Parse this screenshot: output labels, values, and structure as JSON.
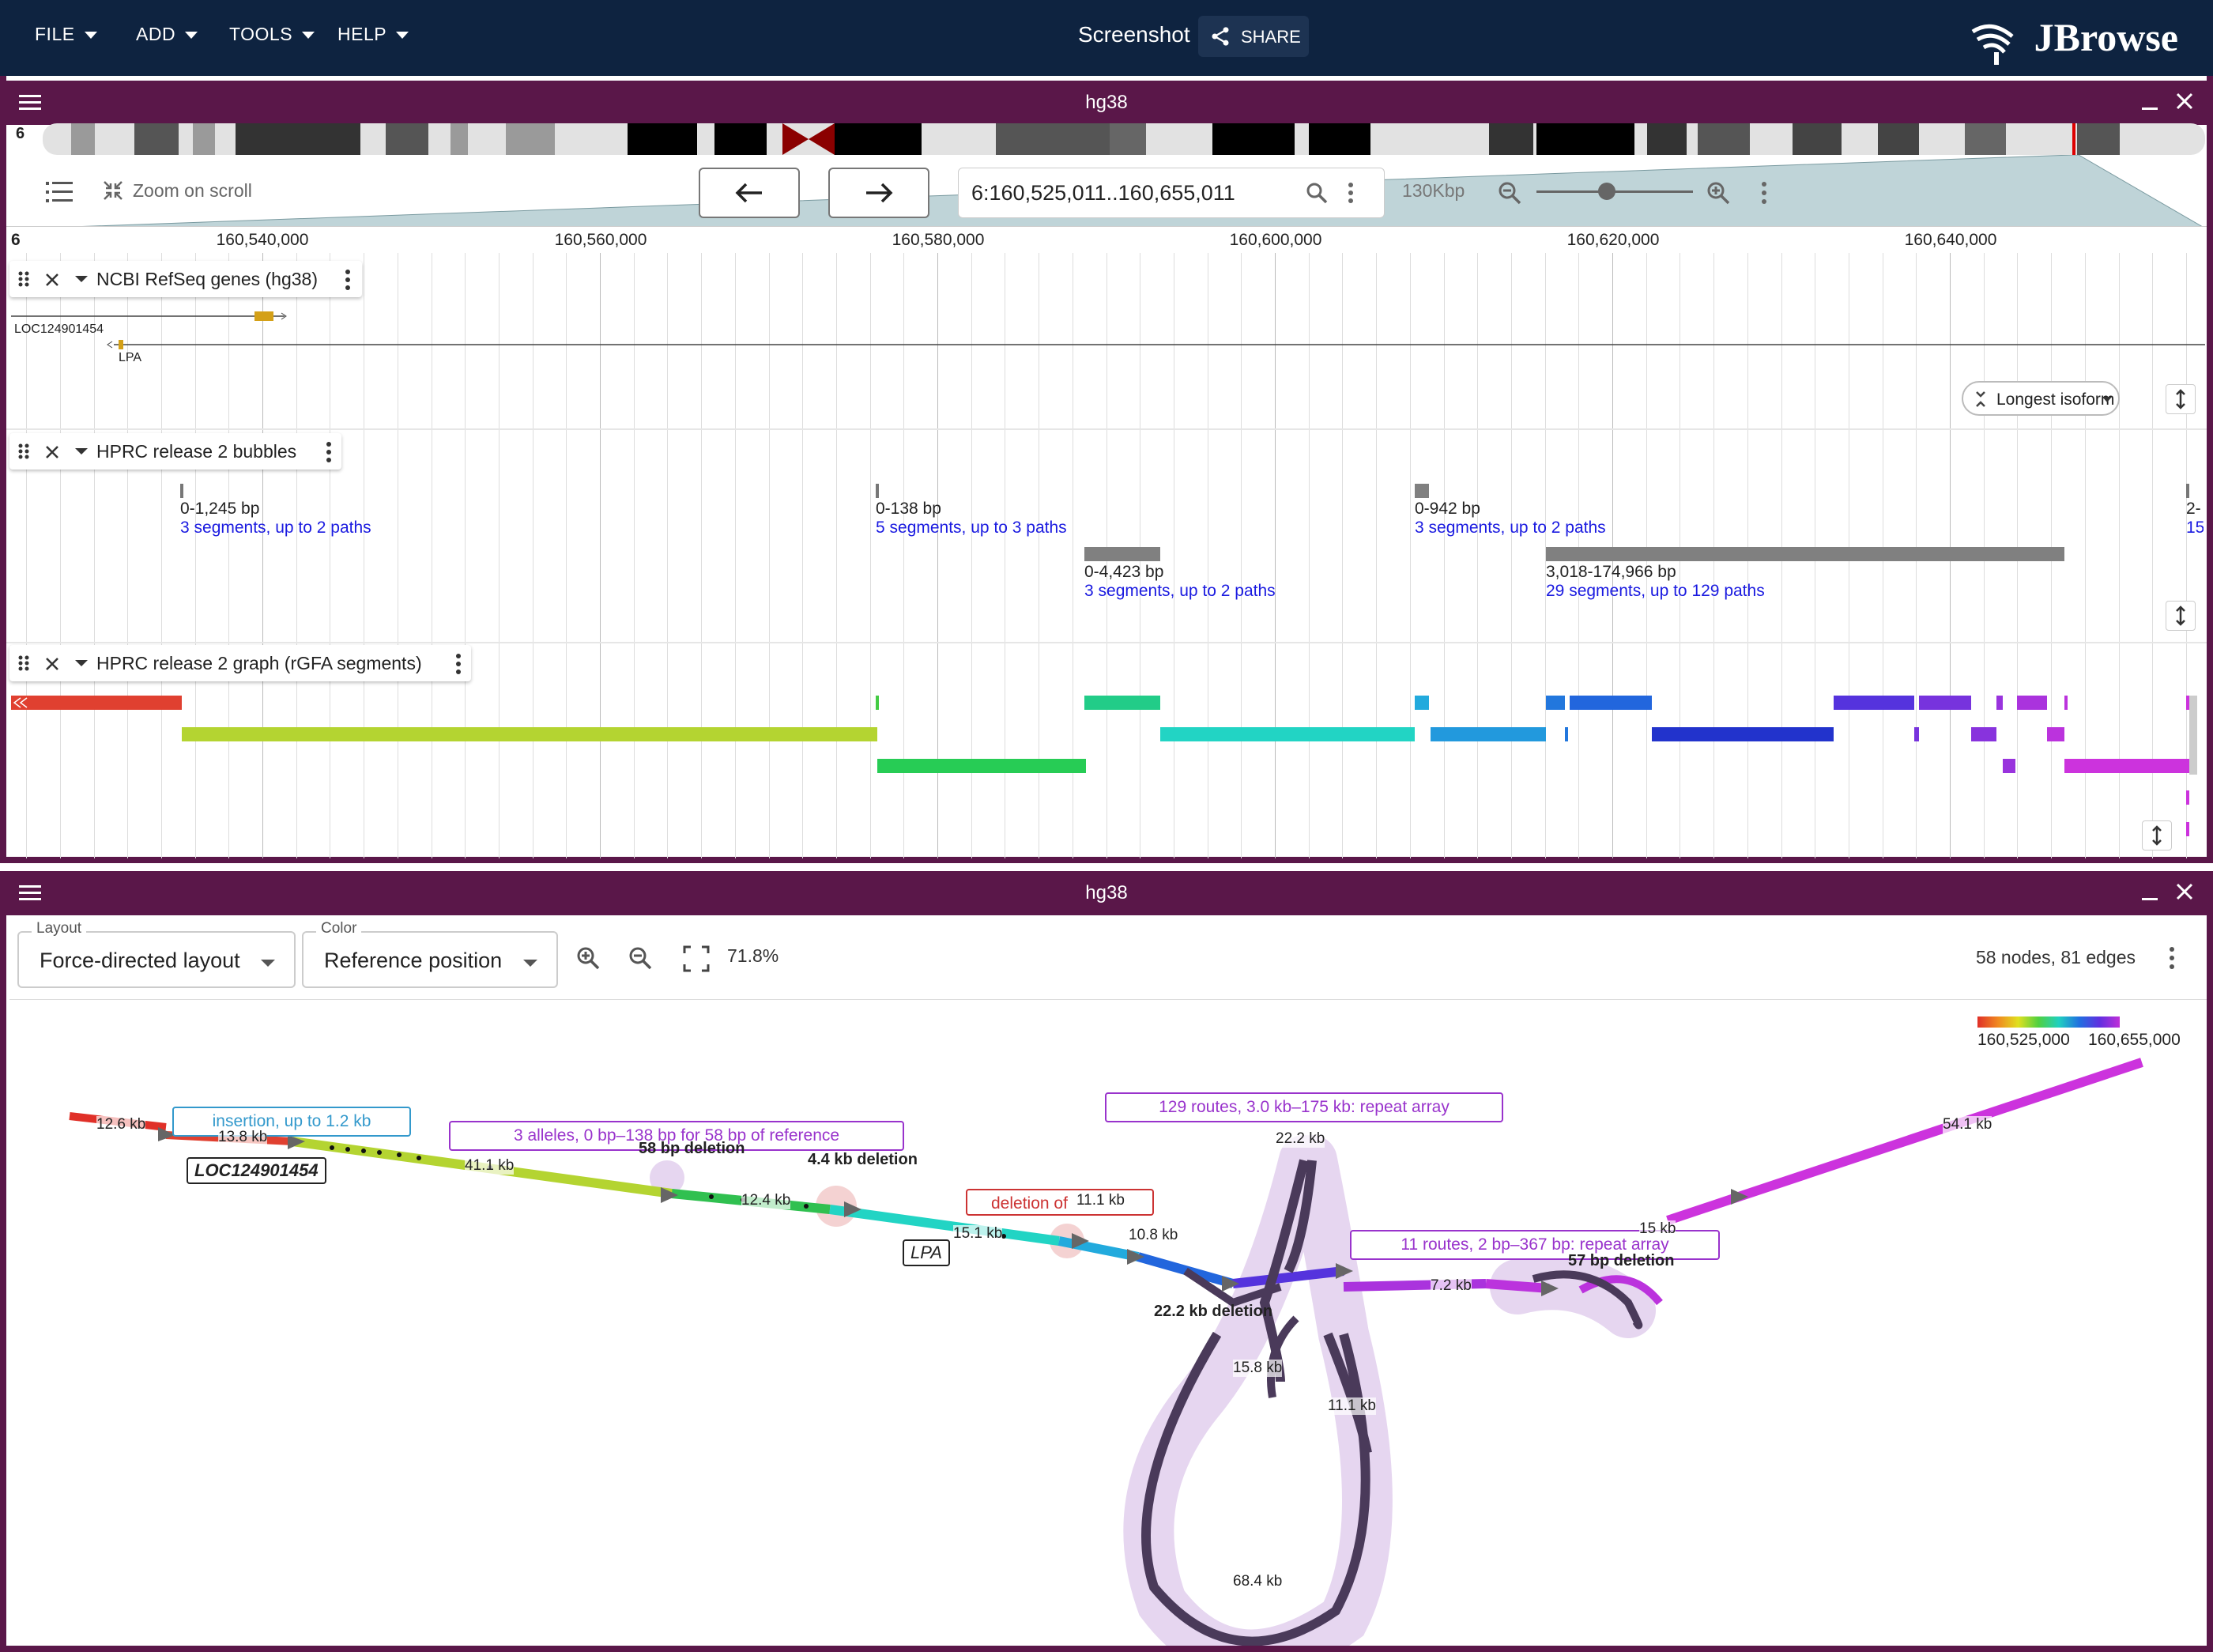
{
  "header": {
    "menus": [
      "FILE",
      "ADD",
      "TOOLS",
      "HELP"
    ],
    "screenshot_label": "Screenshot",
    "share_label": "SHARE",
    "brand": "JBrowse",
    "colors": {
      "header_bg": "#0e2340",
      "view_bar": "#5a1749"
    }
  },
  "linear_view": {
    "title": "hg38",
    "chromosome": "6",
    "zoom_on_scroll_label": "Zoom on scroll",
    "locus": "6:160,525,011..160,655,011",
    "span": "130Kbp",
    "zoom_slider_fraction": 0.45,
    "ruler_chrom": "6",
    "ruler_ticks": [
      "160,540,000",
      "160,560,000",
      "160,580,000",
      "160,600,000",
      "160,620,000",
      "160,640,000"
    ],
    "tracks": {
      "refseq": {
        "name": "NCBI RefSeq genes (hg38)",
        "genes": [
          "LOC124901454",
          "LPA"
        ],
        "isoform_button": "Longest isoform"
      },
      "bubbles": {
        "name": "HPRC release 2 bubbles",
        "items": [
          {
            "size": "0-1,245 bp",
            "desc": "3 segments, up to 2 paths"
          },
          {
            "size": "0-138 bp",
            "desc": "5 segments, up to 3 paths"
          },
          {
            "size": "0-4,423 bp",
            "desc": "3 segments, up to 2 paths"
          },
          {
            "size": "0-942 bp",
            "desc": "3 segments, up to 2 paths"
          },
          {
            "size": "3,018-174,966 bp",
            "desc": "29 segments, up to 129 paths"
          },
          {
            "size": "2-",
            "desc": "15"
          }
        ]
      },
      "graph": {
        "name": "HPRC release 2 graph (rGFA segments)"
      }
    }
  },
  "graph_view": {
    "title": "hg38",
    "layout_legend": "Layout",
    "layout_value": "Force-directed layout",
    "color_legend": "Color",
    "color_value": "Reference position",
    "zoom_percent": "71.8%",
    "stats": "58 nodes, 81 edges",
    "colorbar_start": "160,525,000",
    "colorbar_end": "160,655,000",
    "annotations": {
      "insertion": "insertion, up to 1.2 kb",
      "alleles": "3 alleles, 0 bp–138 bp for 58 bp of reference",
      "routes129": "129 routes, 3.0 kb–175 kb: repeat array",
      "deletion_of": "deletion of",
      "routes11": "11 routes, 2 bp–367 bp: repeat array",
      "del58": "58 bp deletion",
      "del44": "4.4 kb deletion",
      "del222": "22.2 kb deletion",
      "del57": "57 bp deletion",
      "gene_loc": "LOC124901454",
      "gene_lpa": "LPA"
    },
    "lengths": [
      "12.6 kb",
      "13.8 kb",
      "41.1 kb",
      "12.4 kb",
      "15.1 kb",
      "11.1 kb",
      "10.8 kb",
      "22.2 kb",
      "15.8 kb",
      "11.1 kb",
      "68.4 kb",
      "7.2 kb",
      "15 kb",
      "54.1 kb"
    ]
  }
}
